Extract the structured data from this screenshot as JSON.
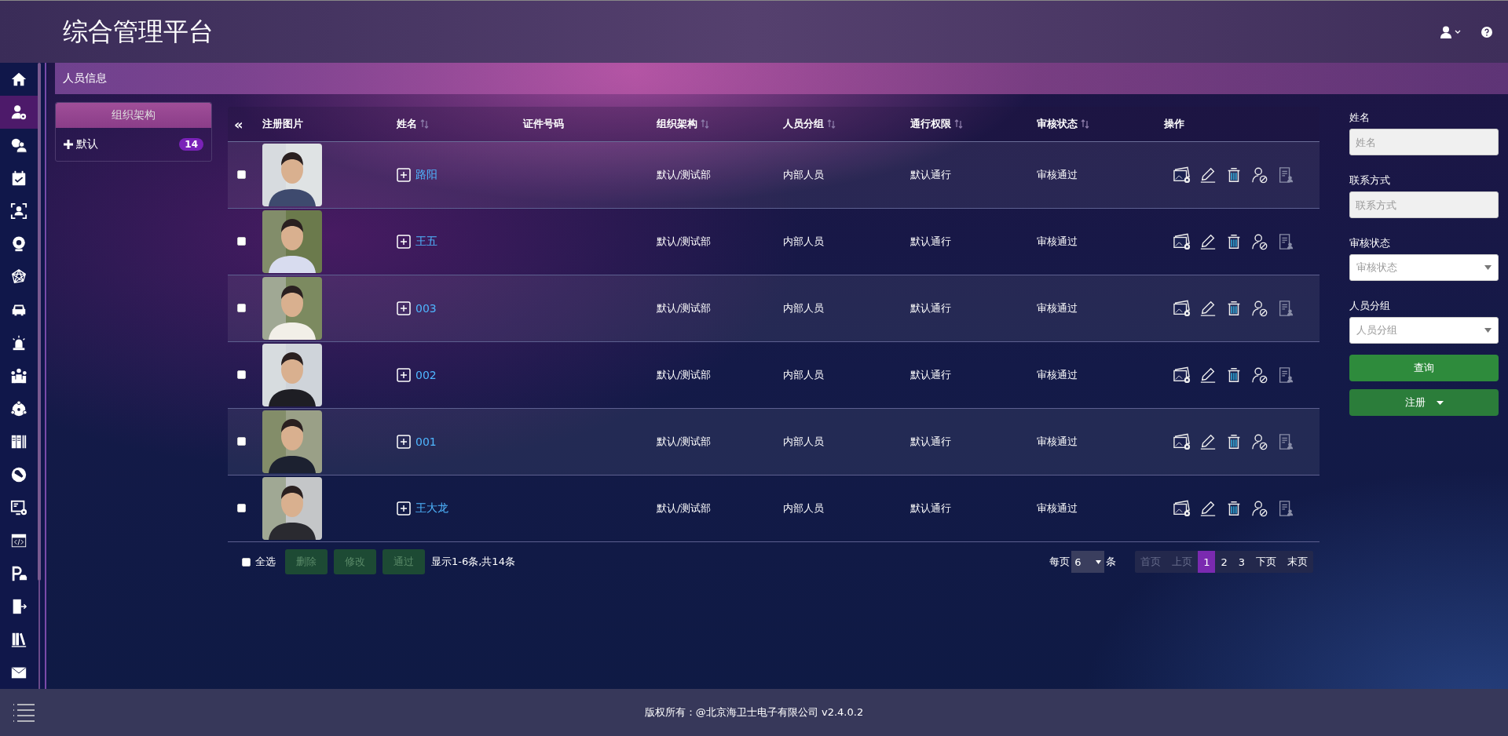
{
  "header": {
    "title": "综合管理平台"
  },
  "sidebar": {
    "items": [
      {
        "selected": false
      },
      {
        "selected": true
      },
      {
        "selected": false
      },
      {
        "selected": false
      },
      {
        "selected": false
      },
      {
        "selected": false
      },
      {
        "selected": false
      },
      {
        "selected": false
      },
      {
        "selected": false
      },
      {
        "selected": false
      },
      {
        "selected": false
      },
      {
        "selected": false
      },
      {
        "selected": false
      },
      {
        "selected": false
      },
      {
        "selected": false
      },
      {
        "selected": false
      },
      {
        "selected": false
      },
      {
        "selected": false
      },
      {
        "selected": false
      }
    ]
  },
  "breadcrumb": "人员信息",
  "org_panel": {
    "title": "组织架构",
    "items": [
      {
        "label": "默认",
        "count": "14",
        "expanded": false
      }
    ]
  },
  "table": {
    "collapse": "«",
    "columns": [
      {
        "label": "注册图片",
        "sortable": false
      },
      {
        "label": "姓名",
        "sortable": true
      },
      {
        "label": "证件号码",
        "sortable": false
      },
      {
        "label": "组织架构",
        "sortable": true
      },
      {
        "label": "人员分组",
        "sortable": true
      },
      {
        "label": "通行权限",
        "sortable": true
      },
      {
        "label": "审核状态",
        "sortable": true
      },
      {
        "label": "操作",
        "sortable": false
      }
    ],
    "rows": [
      {
        "checked": false,
        "expanded": false,
        "name": "路阳",
        "org": "默认/测试部",
        "group": "内部人员",
        "access": "默认通行",
        "status": "审核通过"
      },
      {
        "checked": false,
        "expanded": false,
        "name": "王五",
        "org": "默认/测试部",
        "group": "内部人员",
        "access": "默认通行",
        "status": "审核通过"
      },
      {
        "checked": false,
        "expanded": false,
        "name": "003",
        "org": "默认/测试部",
        "group": "内部人员",
        "access": "默认通行",
        "status": "审核通过"
      },
      {
        "checked": false,
        "expanded": false,
        "name": "002",
        "org": "默认/测试部",
        "group": "内部人员",
        "access": "默认通行",
        "status": "审核通过"
      },
      {
        "checked": false,
        "expanded": false,
        "name": "001",
        "org": "默认/测试部",
        "group": "内部人员",
        "access": "默认通行",
        "status": "审核通过"
      },
      {
        "checked": false,
        "expanded": false,
        "name": "王大龙",
        "org": "默认/测试部",
        "group": "内部人员",
        "access": "默认通行",
        "status": "审核通过"
      }
    ]
  },
  "table_footer": {
    "select_all": {
      "label": "全选",
      "checked": false
    },
    "buttons": [
      {
        "label": "删除",
        "disabled": true
      },
      {
        "label": "修改",
        "disabled": true
      },
      {
        "label": "通过",
        "disabled": true
      }
    ],
    "summary": "显示1-6条,共14条",
    "pagination": {
      "per_page_label": "每页",
      "per_page": "6",
      "unit": "条",
      "pages": [
        {
          "label": "首页",
          "selected": false,
          "disabled": true
        },
        {
          "label": "上页",
          "selected": false,
          "disabled": true
        },
        {
          "label": "1",
          "selected": true,
          "disabled": false
        },
        {
          "label": "2",
          "selected": false,
          "disabled": false
        },
        {
          "label": "3",
          "selected": false,
          "disabled": false
        },
        {
          "label": "下页",
          "selected": false,
          "disabled": false
        },
        {
          "label": "末页",
          "selected": false,
          "disabled": false
        }
      ]
    }
  },
  "filter": {
    "fields": [
      {
        "kind": "text",
        "label": "姓名",
        "placeholder": "姓名"
      },
      {
        "kind": "text",
        "label": "联系方式",
        "placeholder": "联系方式"
      },
      {
        "kind": "select",
        "label": "审核状态",
        "placeholder": "审核状态"
      },
      {
        "kind": "select",
        "label": "人员分组",
        "placeholder": "人员分组"
      }
    ],
    "buttons": [
      {
        "kind": "button",
        "label": "查询"
      },
      {
        "kind": "dropdown",
        "label": "注册"
      }
    ]
  },
  "footer": {
    "copyright": "版权所有：@北京海卫士电子有限公司 v2.4.0.2"
  }
}
